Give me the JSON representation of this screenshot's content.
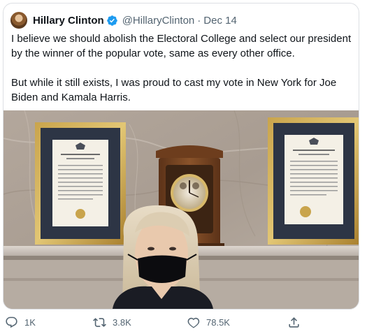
{
  "tweet": {
    "author_name": "Hillary Clinton",
    "handle": "@HillaryClinton",
    "separator": "·",
    "date": "Dec 14",
    "paragraphs": [
      "I believe we should abolish the Electoral College and select our president by the winner of the popular vote, same as every other office.",
      "But while it still exists, I was proud to cast my vote in New York for Joe Biden and Kamala Harris."
    ]
  },
  "actions": {
    "reply_count": "1K",
    "retweet_count": "3.8K",
    "like_count": "78.5K"
  },
  "icons": {
    "verified": "verified-badge-icon",
    "reply": "reply-icon",
    "retweet": "retweet-icon",
    "like": "heart-icon",
    "share": "share-icon"
  },
  "colors": {
    "verified": "#1d9bf0",
    "secondary_text": "#536471",
    "border": "#dcdfe3"
  }
}
